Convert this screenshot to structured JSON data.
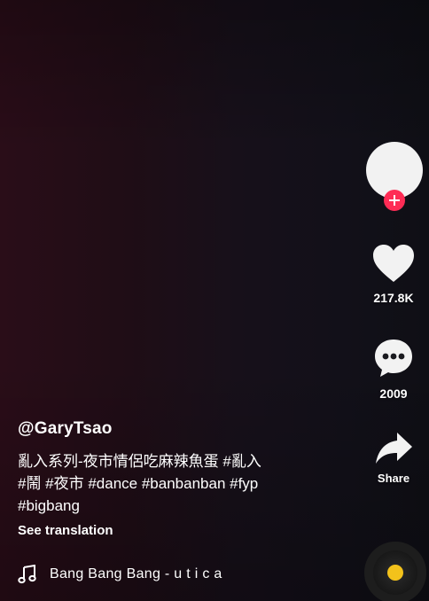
{
  "creator": {
    "username": "@GaryTsao"
  },
  "caption": {
    "line1": "亂入系列-夜市情侶吃麻辣魚蛋 #亂入",
    "line2": "#鬧 #夜市 #dance #banbanban #fyp",
    "line3": "#bigbang"
  },
  "see_translation_label": "See translation",
  "music": {
    "icon": "music-note-icon",
    "title": "Bang Bang Bang - u t i c a"
  },
  "actions": {
    "like_count": "217.8K",
    "comment_count": "2009",
    "share_label": "Share"
  },
  "icons": {
    "follow": "plus-icon",
    "like": "heart-icon",
    "comment": "comment-bubble-icon",
    "share": "share-arrow-icon",
    "disc": "music-disc-icon"
  },
  "colors": {
    "follow_accent": "#fe2c55",
    "disc_center": "#f3c21b",
    "text": "#ffffff"
  }
}
